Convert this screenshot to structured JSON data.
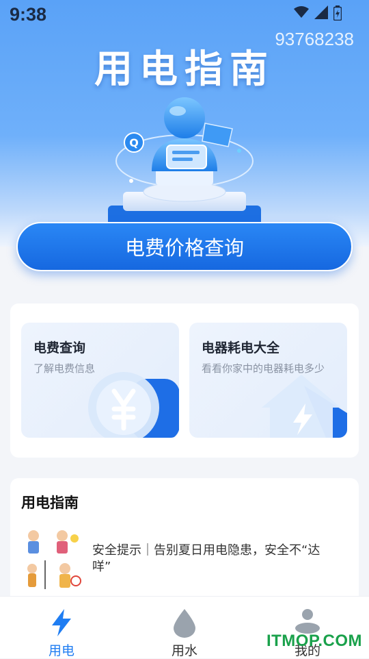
{
  "status_bar": {
    "time": "9:38"
  },
  "watermark": "93768238",
  "hero": {
    "title": "用电指南"
  },
  "query_button": {
    "label": "电费价格查询"
  },
  "features": [
    {
      "title": "电费查询",
      "subtitle": "了解电费信息",
      "icon": "yuan-coin-icon"
    },
    {
      "title": "电器耗电大全",
      "subtitle": "看看你家中的电器耗电多少",
      "icon": "house-lightning-icon"
    }
  ],
  "guide": {
    "title": "用电指南",
    "articles": [
      {
        "text": "安全提示｜告别夏日用电隐患，安全不“达咩”"
      }
    ]
  },
  "tabs": [
    {
      "label": "用电",
      "icon": "lightning-icon",
      "active": true
    },
    {
      "label": "用水",
      "icon": "water-drop-icon",
      "active": false
    },
    {
      "label": "我的",
      "icon": "user-icon",
      "active": false
    }
  ],
  "brand": "ITMOP.COM",
  "colors": {
    "accent": "#1668e0",
    "active_tab": "#1f7df2",
    "inactive_tab": "#333333"
  }
}
